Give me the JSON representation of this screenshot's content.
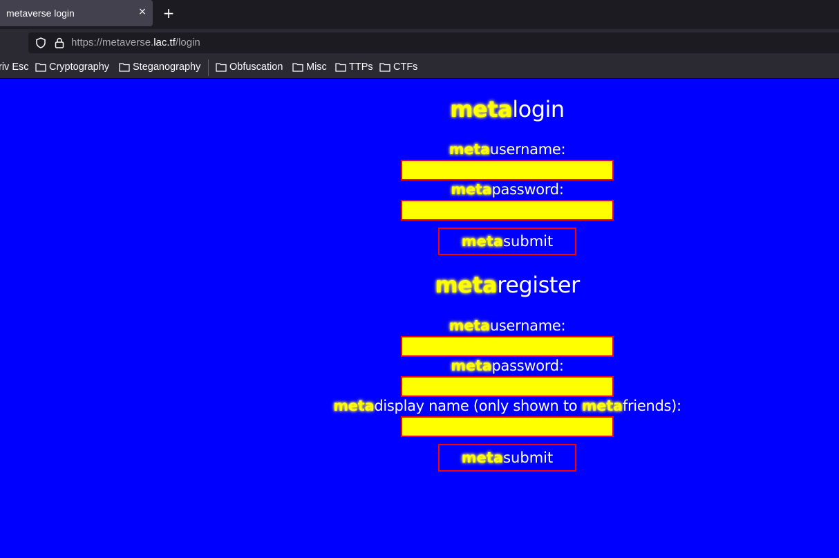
{
  "browser": {
    "tab_title": "metaverse login",
    "tab_close": "×",
    "new_tab": "+",
    "url_prefix": "https://metaverse.",
    "url_host": "lac.tf",
    "url_path": "/login"
  },
  "bookmarks": [
    "riv Esc",
    "Cryptography",
    "Steganography",
    "Obfuscation",
    "Misc",
    "TTPs",
    "CTFs"
  ],
  "login": {
    "title_meta": "meta",
    "title_rest": "login",
    "username_meta": "meta",
    "username_rest": "username:",
    "password_meta": "meta",
    "password_rest": "password:",
    "submit_meta": "meta",
    "submit_rest": "submit"
  },
  "register": {
    "title_meta": "meta",
    "title_rest": "register",
    "username_meta": "meta",
    "username_rest": "username:",
    "password_meta": "meta",
    "password_rest": "password:",
    "display_meta": "meta",
    "display_rest_a": "display name (only shown to ",
    "display_meta2": "meta",
    "display_rest_b": "friends):",
    "submit_meta": "meta",
    "submit_rest": "submit"
  },
  "colors": {
    "background": "#0000ff",
    "meta": "#ffff00",
    "field": "#ffff00",
    "border": "#ff0000"
  }
}
